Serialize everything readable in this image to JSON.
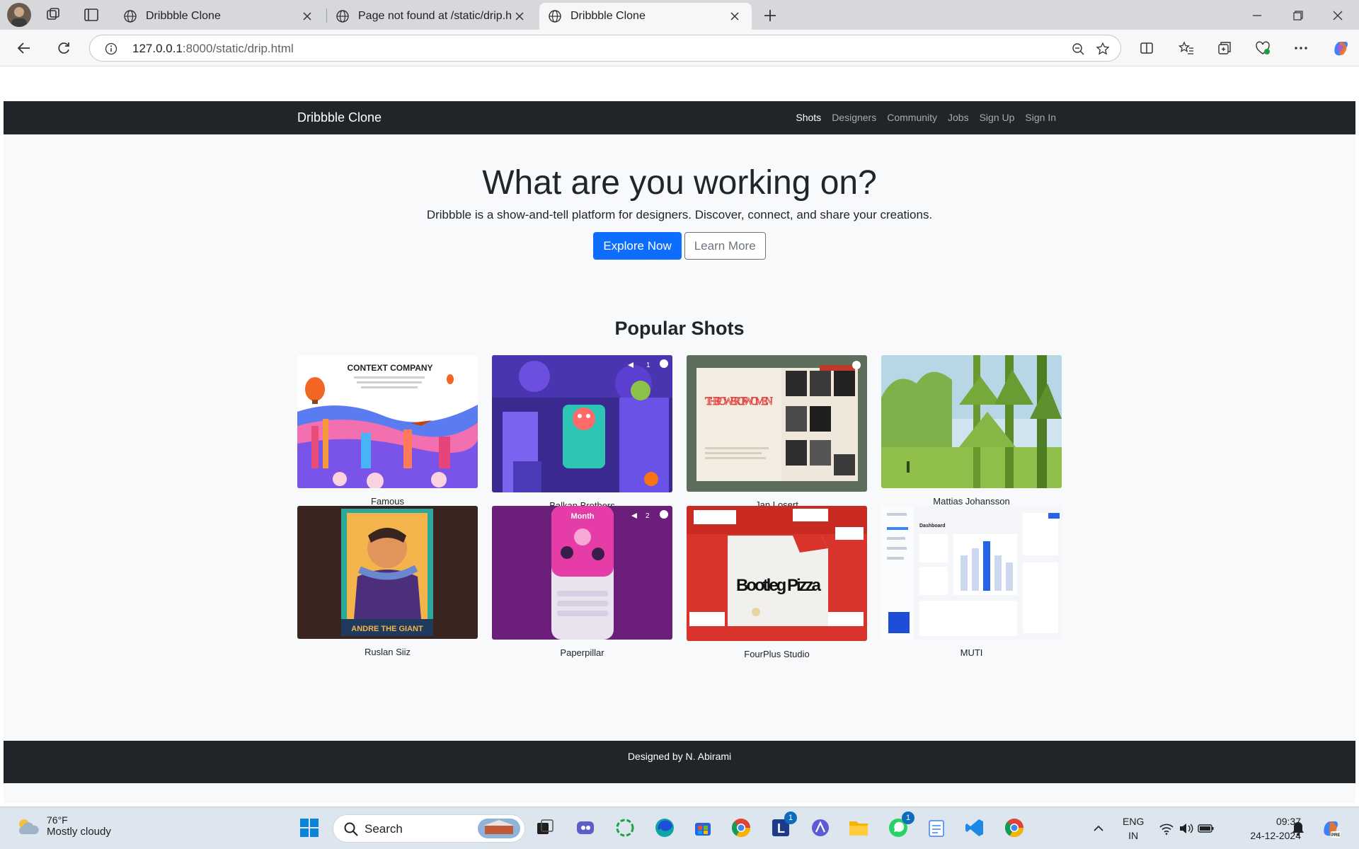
{
  "browser": {
    "tabs": [
      {
        "title": "Dribbble Clone",
        "active": false
      },
      {
        "title": "Page not found at /static/drip.html",
        "active": false
      },
      {
        "title": "Dribbble Clone",
        "active": true
      }
    ],
    "url_host": "127.0.0.1",
    "url_rest": ":8000/static/drip.html"
  },
  "navbar": {
    "brand": "Dribbble Clone",
    "links": [
      "Shots",
      "Designers",
      "Community",
      "Jobs",
      "Sign Up",
      "Sign In"
    ]
  },
  "hero": {
    "title": "What are you working on?",
    "subtitle": "Dribbble is a show-and-tell platform for designers. Discover, connect, and share your creations.",
    "primary_button": "Explore Now",
    "secondary_button": "Learn More"
  },
  "popular": {
    "title": "Popular Shots",
    "shots": [
      {
        "designer": "Famous",
        "image_text": "CONTEXT COMPANY"
      },
      {
        "designer": "Balkan Brothers",
        "image_text": "1"
      },
      {
        "designer": "Jan Losert",
        "image_text": "THE POWER OF WOMEN"
      },
      {
        "designer": "Mattias Johansson",
        "image_text": ""
      },
      {
        "designer": "Ruslan Siiz",
        "image_text": "ANDRE THE GIANT"
      },
      {
        "designer": "Paperpillar",
        "image_text": "Month"
      },
      {
        "designer": "FourPlus Studio",
        "image_text": "Bootleg Pizza"
      },
      {
        "designer": "MUTI",
        "image_text": "Dashboard"
      }
    ]
  },
  "footer": {
    "text": "Designed by N. Abirami"
  },
  "taskbar": {
    "weather_temp": "76°F",
    "weather_desc": "Mostly cloudy",
    "search_label": "Search",
    "lang_line1": "ENG",
    "lang_line2": "IN",
    "time": "09:37",
    "date": "24-12-2024",
    "badge_count_1": "1",
    "badge_count_2": "1"
  },
  "colors": {
    "navbar_bg": "#212529",
    "primary": "#0d6efd",
    "page_bg": "#f8f9fa"
  }
}
